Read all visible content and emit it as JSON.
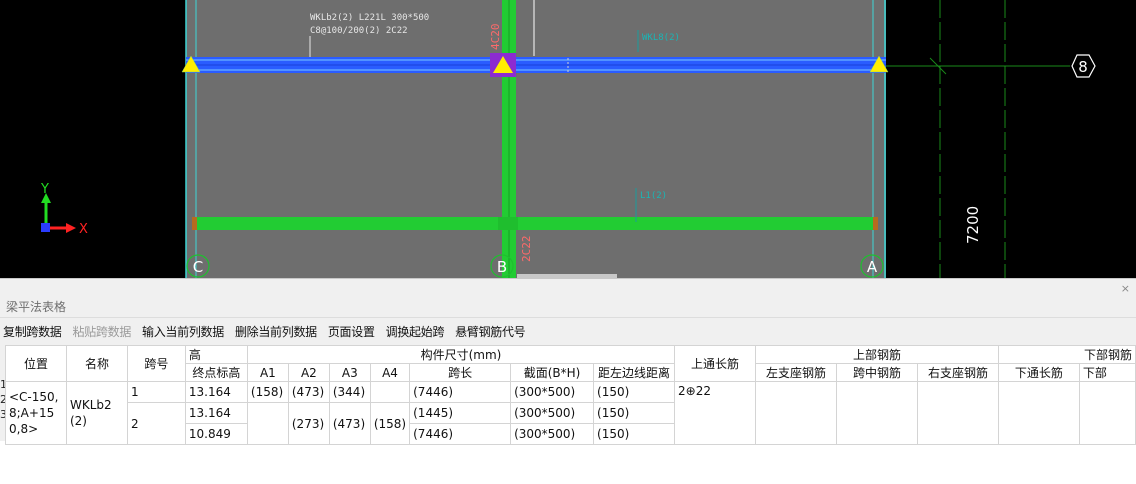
{
  "cad": {
    "beam_label_line1": "WKLb2(2) L221L 300*500",
    "beam_label_line2": "C8@100/200(2) 2C22",
    "rebar_top": "4C20",
    "rebar_bottom": "2C22",
    "small_label_top": "WKL8(2)",
    "small_label_mid": "L1(2)",
    "axis_C": "C",
    "axis_B": "B",
    "axis_A": "A",
    "axis_8": "8",
    "dimension": "7200",
    "ucs_x": "X",
    "ucs_y": "Y"
  },
  "panel": {
    "title": "梁平法表格",
    "close": "×",
    "toolbar": [
      "复制跨数据",
      "粘贴跨数据",
      "输入当前列数据",
      "删除当前列数据",
      "页面设置",
      "调换起始跨",
      "悬臂钢筋代号"
    ],
    "row_numbers": [
      "1",
      "2",
      "3"
    ],
    "headers": {
      "pos": "位置",
      "name": "名称",
      "span": "跨号",
      "height": "高",
      "end_elev": "终点标高",
      "dims": "构件尺寸(mm)",
      "a1": "A1",
      "a2": "A2",
      "a3": "A3",
      "a4": "A4",
      "span_len": "跨长",
      "section": "截面(B*H)",
      "left_dist": "距左边线距离",
      "top_cont": "上通长筋",
      "top_rebar": "上部钢筋",
      "left_support": "左支座钢筋",
      "mid_span": "跨中钢筋",
      "right_support": "右支座钢筋",
      "bottom_rebar": "下部钢筋",
      "bottom_cont": "下通长筋",
      "bottom_more": "下部"
    },
    "rows": {
      "pos": "<C-150,8;A+150,8>",
      "name": "WKLb2(2)",
      "r1": {
        "span": "1",
        "end_elev": "13.164",
        "a1": "(158)",
        "a2": "(473)",
        "a3": "(344)",
        "a4": "",
        "span_len": "(7446)",
        "section": "(300*500)",
        "left_dist": "(150)",
        "top_cont": "2⊕22"
      },
      "r2": {
        "span": "2",
        "end_elev": "13.164",
        "span_len": "(1445)",
        "section": "(300*500)",
        "left_dist": "(150)"
      },
      "r3": {
        "end_elev": "10.849",
        "a2": "(273)",
        "a3": "(473)",
        "a4": "(158)",
        "span_len": "(7446)",
        "section": "(300*500)",
        "left_dist": "(150)"
      }
    }
  }
}
